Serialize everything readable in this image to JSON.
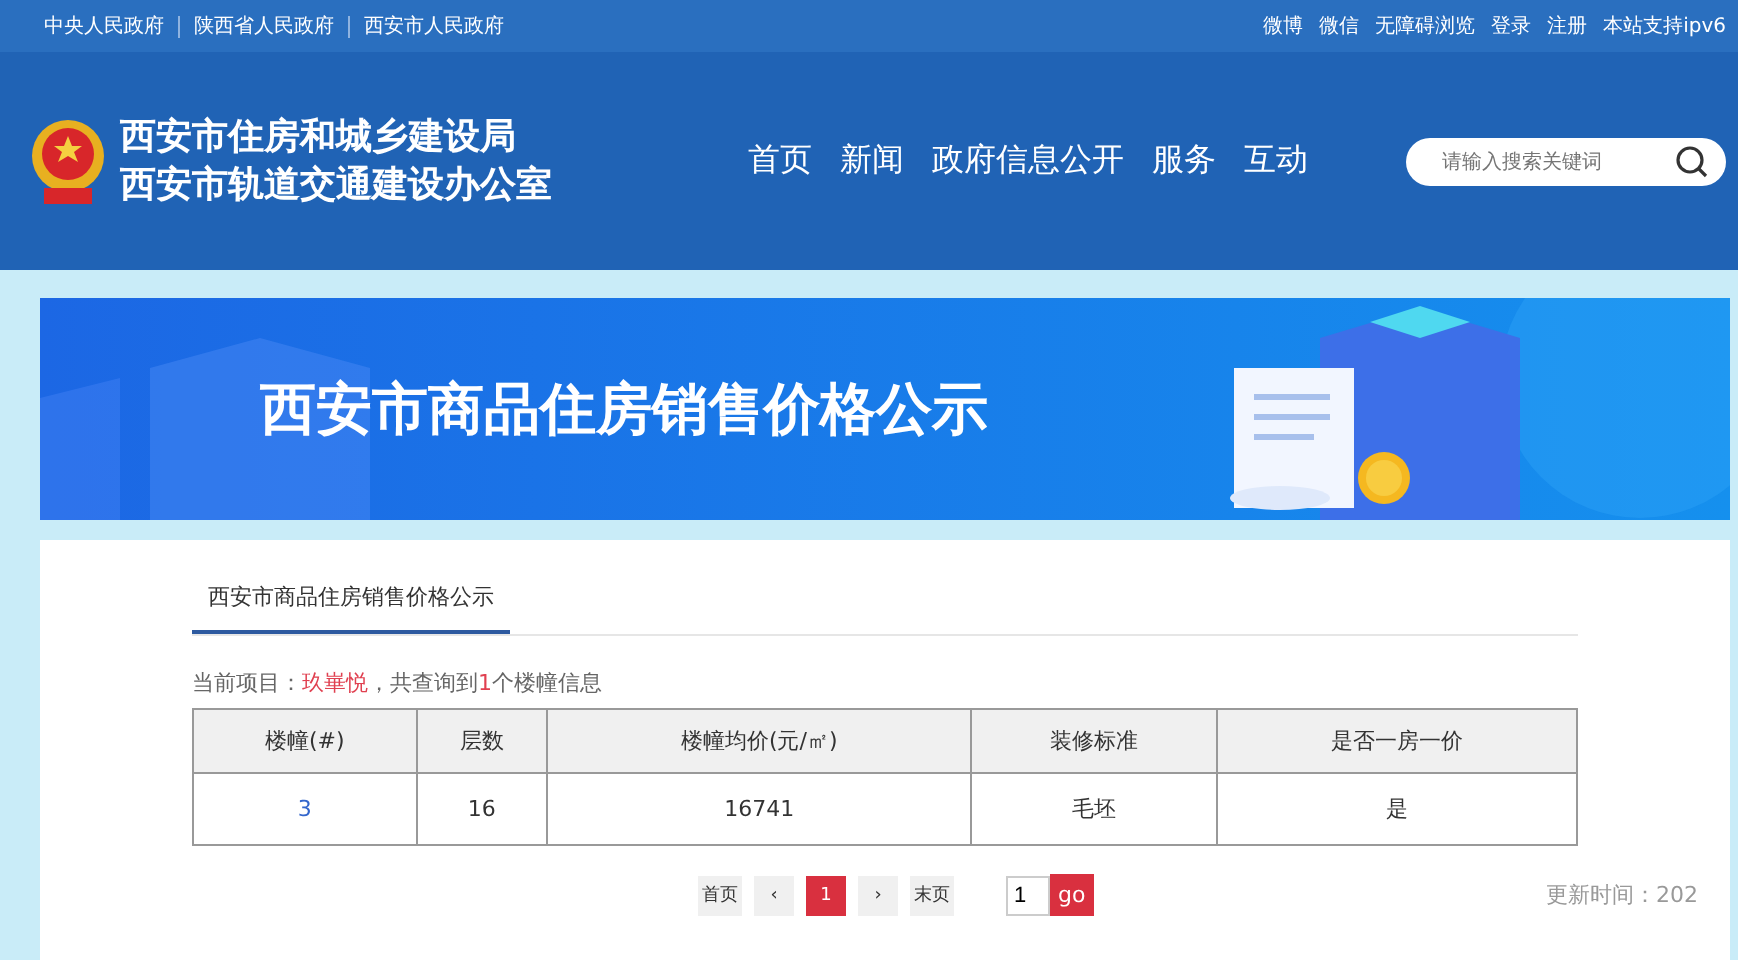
{
  "top_links": [
    "中央人民政府",
    "陕西省人民政府",
    "西安市人民政府"
  ],
  "top_right": [
    "微博",
    "微信",
    "无障碍浏览",
    "登录",
    "注册",
    "本站支持ipv6"
  ],
  "site_title": [
    "西安市住房和城乡建设局",
    "西安市轨道交通建设办公室"
  ],
  "nav": [
    "首页",
    "新闻",
    "政府信息公开",
    "服务",
    "互动"
  ],
  "search": {
    "placeholder": "请输入搜索关键词"
  },
  "banner": {
    "title": "西安市商品住房销售价格公示"
  },
  "tab": {
    "label": "西安市商品住房销售价格公示",
    "selected": true
  },
  "summary": {
    "prefix": "当前项目：",
    "project": "玖崋悦",
    "middle": "，共查询到",
    "count": "1",
    "suffix": "个楼幢信息"
  },
  "table": {
    "columns": [
      "楼幢(#)",
      "层数",
      "楼幢均价(元/㎡)",
      "装修标准",
      "是否一房一价"
    ],
    "rows": [
      [
        "3",
        "16",
        "16741",
        "毛坯",
        "是"
      ]
    ]
  },
  "pagination": {
    "first": "首页",
    "prev": "‹",
    "pages": [
      {
        "label": "1",
        "selected": true
      }
    ],
    "next": "›",
    "last": "末页",
    "jump_value": "1",
    "go": "go"
  },
  "updated": "更新时间：202"
}
